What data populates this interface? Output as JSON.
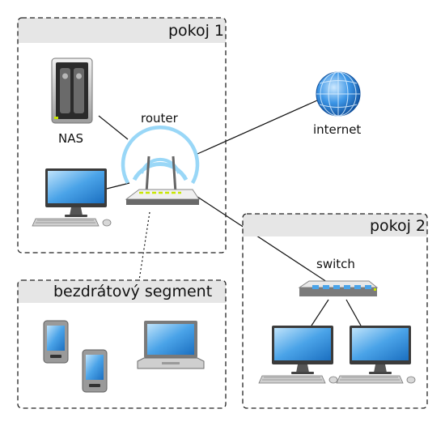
{
  "zones": {
    "room1": {
      "title": "pokoj 1"
    },
    "room2": {
      "title": "pokoj 2"
    },
    "wireless": {
      "title": "bezdrátový segment"
    }
  },
  "devices": {
    "nas": "NAS",
    "router": "router",
    "internet": "internet",
    "switch": "switch"
  },
  "colors": {
    "zone_header": "#e6e6e6",
    "zone_border": "#222222",
    "screen_blue": "#4aa3e8",
    "wifi_arc": "#8fd3f7",
    "device_gray": "#9a9a9a",
    "led_green": "#c8e600",
    "globe_blue": "#2e86de"
  },
  "icons": [
    "nas-icon",
    "desktop-icon",
    "router-icon",
    "globe-icon",
    "switch-icon",
    "tablet-icon",
    "phone-icon",
    "laptop-icon"
  ]
}
